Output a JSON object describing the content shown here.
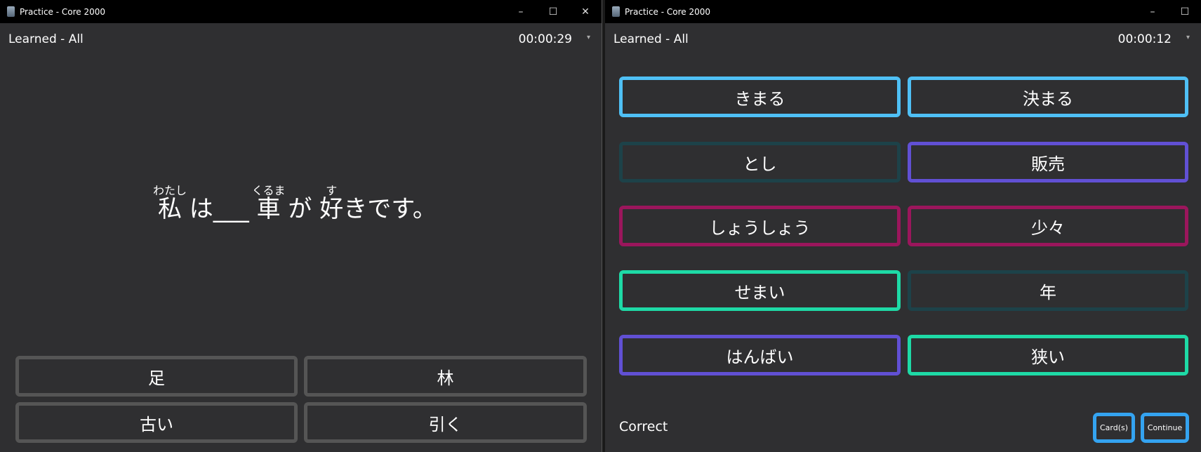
{
  "windows": [
    {
      "title": "Practice - Core 2000",
      "deck": "Learned - All",
      "timer": "00:00:29",
      "sentence": {
        "parts": [
          {
            "text": "私",
            "ruby": "わたし"
          },
          {
            "text": " は___ "
          },
          {
            "text": "車",
            "ruby": "くるま"
          },
          {
            "text": " が "
          },
          {
            "text": "好",
            "ruby": "す"
          },
          {
            "text": "きです。"
          }
        ]
      },
      "choices": [
        "足",
        "林",
        "古い",
        "引く"
      ]
    },
    {
      "title": "Practice - Core 2000",
      "deck": "Learned - All",
      "timer": "00:00:12",
      "pairs": [
        {
          "left": "きまる",
          "right": "決まる",
          "left_color": "#4fc0f5",
          "right_color": "#4fc0f5"
        },
        {
          "left": "とし",
          "right": "販売",
          "left_color": "#1d4249",
          "right_color": "#6150d4"
        },
        {
          "left": "しょうしょう",
          "right": "少々",
          "left_color": "#9b165c",
          "right_color": "#9b165c"
        },
        {
          "left": "せまい",
          "right": "年",
          "left_color": "#1edaa6",
          "right_color": "#1d4249"
        },
        {
          "left": "はんばい",
          "right": "狭い",
          "left_color": "#6150d4",
          "right_color": "#1edaa6"
        }
      ],
      "status": "Correct",
      "cards_label": "Card(s)",
      "continue_label": "Continue"
    }
  ],
  "controls": {
    "minimize": "–",
    "maximize": "☐",
    "close": "✕",
    "dropdown": "▾"
  }
}
